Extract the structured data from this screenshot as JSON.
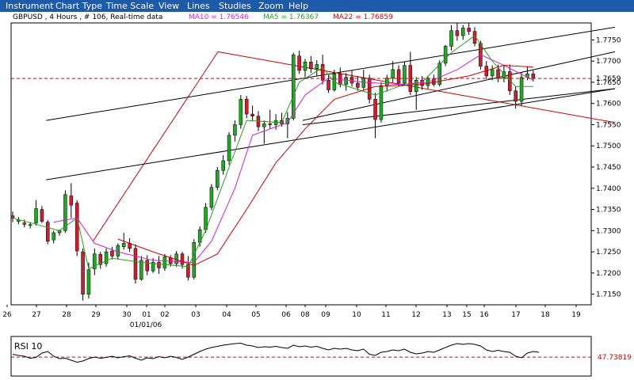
{
  "menu": {
    "items": [
      "Instrument",
      "Chart Type",
      "Time Scale",
      "View",
      "Lines",
      "Studies",
      "Zoom",
      "Help"
    ]
  },
  "header": {
    "instrument_text": "GBPUSD , 4 Hours , # 106, Real-time data",
    "ma10_text": "MA10 = 1.76546",
    "ma5_text": "MA5 = 1.76367",
    "ma22_text": "MA22 = 1.76859"
  },
  "rsi_panel": {
    "title": "RSI 10",
    "value_label": "47.73819"
  },
  "colors": {
    "menu_bg": "#1f5aa8",
    "bull": "#22a822",
    "bear": "#cc1f2e",
    "ma5": "#1fa31f",
    "ma10": "#d21fd2",
    "ma22": "#d00000",
    "trend_red": "#cc0000",
    "channel": "#000000",
    "last_price": "#e00000"
  },
  "chart_data": [
    {
      "type": "candlestick",
      "instrument": "GBPUSD",
      "timeframe": "4 Hours",
      "ylim": [
        1.7125,
        1.779
      ],
      "y_ticks": [
        "1.7750",
        "1.7700",
        "1.7650",
        "1.7600",
        "1.7550",
        "1.7500",
        "1.7450",
        "1.7400",
        "1.7350",
        "1.7300",
        "1.7250",
        "1.7200",
        "1.7150"
      ],
      "last_price_label": "1.7659",
      "last_price": 1.7659,
      "x_labels": [
        "26",
        "27",
        "28",
        "29",
        "30",
        "01",
        "02",
        "03",
        "04",
        "05",
        "06",
        "08",
        "09",
        "10",
        "11",
        "12",
        "13",
        "15",
        "16",
        "17",
        "18",
        "19"
      ],
      "x_sublabel": "01/01/06",
      "candles": [
        [
          1.7335,
          1.7345,
          1.732,
          1.733
        ],
        [
          1.7322,
          1.7332,
          1.7315,
          1.7325
        ],
        [
          1.7318,
          1.7326,
          1.7308,
          1.7315
        ],
        [
          1.7312,
          1.732,
          1.7305,
          1.7314
        ],
        [
          1.7318,
          1.7372,
          1.7312,
          1.7352
        ],
        [
          1.735,
          1.7358,
          1.7318,
          1.7322
        ],
        [
          1.732,
          1.7325,
          1.7268,
          1.7275
        ],
        [
          1.7278,
          1.73,
          1.727,
          1.7295
        ],
        [
          1.7295,
          1.7302,
          1.7288,
          1.73
        ],
        [
          1.73,
          1.7395,
          1.7295,
          1.7385
        ],
        [
          1.7382,
          1.7412,
          1.733,
          1.736
        ],
        [
          1.7365,
          1.7372,
          1.724,
          1.7252
        ],
        [
          1.725,
          1.7258,
          1.7135,
          1.715
        ],
        [
          1.715,
          1.7225,
          1.714,
          1.7208
        ],
        [
          1.721,
          1.7258,
          1.7195,
          1.7245
        ],
        [
          1.7244,
          1.725,
          1.721,
          1.722
        ],
        [
          1.7222,
          1.7258,
          1.7215,
          1.725
        ],
        [
          1.7252,
          1.7262,
          1.7232,
          1.724
        ],
        [
          1.724,
          1.727,
          1.7232,
          1.7265
        ],
        [
          1.7262,
          1.7295,
          1.7255,
          1.727
        ],
        [
          1.727,
          1.7282,
          1.725,
          1.7258
        ],
        [
          1.7258,
          1.7268,
          1.7175,
          1.7185
        ],
        [
          1.7185,
          1.724,
          1.7182,
          1.723
        ],
        [
          1.723,
          1.7242,
          1.7195,
          1.7205
        ],
        [
          1.7205,
          1.7235,
          1.72,
          1.7225
        ],
        [
          1.7225,
          1.724,
          1.7198,
          1.7212
        ],
        [
          1.7212,
          1.7245,
          1.7205,
          1.7238
        ],
        [
          1.7236,
          1.7242,
          1.7215,
          1.7222
        ],
        [
          1.7222,
          1.7252,
          1.7215,
          1.7245
        ],
        [
          1.7245,
          1.725,
          1.721,
          1.722
        ],
        [
          1.722,
          1.724,
          1.7182,
          1.719
        ],
        [
          1.719,
          1.728,
          1.7185,
          1.7272
        ],
        [
          1.7272,
          1.731,
          1.7262,
          1.7302
        ],
        [
          1.7302,
          1.7365,
          1.7295,
          1.7355
        ],
        [
          1.7355,
          1.741,
          1.7348,
          1.7402
        ],
        [
          1.7402,
          1.745,
          1.7395,
          1.7442
        ],
        [
          1.7442,
          1.7478,
          1.7432,
          1.7465
        ],
        [
          1.7465,
          1.7532,
          1.7455,
          1.7525
        ],
        [
          1.7525,
          1.756,
          1.751,
          1.755
        ],
        [
          1.755,
          1.762,
          1.754,
          1.761
        ],
        [
          1.761,
          1.7618,
          1.7565,
          1.7575
        ],
        [
          1.7575,
          1.7595,
          1.756,
          1.757
        ],
        [
          1.757,
          1.7582,
          1.7535,
          1.7545
        ],
        [
          1.7545,
          1.756,
          1.7505,
          1.7552
        ],
        [
          1.7552,
          1.7585,
          1.754,
          1.755
        ],
        [
          1.755,
          1.7575,
          1.7538,
          1.756
        ],
        [
          1.756,
          1.7578,
          1.7545,
          1.7552
        ],
        [
          1.7552,
          1.758,
          1.7518,
          1.7565
        ],
        [
          1.7565,
          1.772,
          1.756,
          1.7715
        ],
        [
          1.7712,
          1.7725,
          1.767,
          1.7678
        ],
        [
          1.7678,
          1.7705,
          1.7662,
          1.7698
        ],
        [
          1.7698,
          1.7712,
          1.7672,
          1.7682
        ],
        [
          1.7682,
          1.7702,
          1.7665,
          1.7692
        ],
        [
          1.7692,
          1.7715,
          1.7645,
          1.7655
        ],
        [
          1.7655,
          1.7668,
          1.7625,
          1.7632
        ],
        [
          1.7632,
          1.768,
          1.7628,
          1.767
        ],
        [
          1.767,
          1.7685,
          1.7638,
          1.7645
        ],
        [
          1.7645,
          1.7672,
          1.763,
          1.7662
        ],
        [
          1.7662,
          1.7678,
          1.764,
          1.7648
        ],
        [
          1.7648,
          1.7665,
          1.763,
          1.7638
        ],
        [
          1.7638,
          1.768,
          1.7632,
          1.766
        ],
        [
          1.766,
          1.7668,
          1.76,
          1.761
        ],
        [
          1.761,
          1.7625,
          1.7518,
          1.7562
        ],
        [
          1.7562,
          1.765,
          1.7555,
          1.7642
        ],
        [
          1.7642,
          1.7668,
          1.7628,
          1.766
        ],
        [
          1.766,
          1.77,
          1.765,
          1.768
        ],
        [
          1.768,
          1.769,
          1.764,
          1.7648
        ],
        [
          1.7648,
          1.7698,
          1.7642,
          1.769
        ],
        [
          1.769,
          1.7722,
          1.762,
          1.7628
        ],
        [
          1.7628,
          1.7662,
          1.7585,
          1.7655
        ],
        [
          1.7655,
          1.7665,
          1.7632,
          1.7642
        ],
        [
          1.7642,
          1.7665,
          1.7635,
          1.7658
        ],
        [
          1.7658,
          1.7668,
          1.764,
          1.7645
        ],
        [
          1.7645,
          1.7702,
          1.764,
          1.7695
        ],
        [
          1.7695,
          1.7738,
          1.7688,
          1.7735
        ],
        [
          1.7735,
          1.7785,
          1.7725,
          1.7772
        ],
        [
          1.7772,
          1.779,
          1.7748,
          1.776
        ],
        [
          1.776,
          1.7785,
          1.775,
          1.7778
        ],
        [
          1.7778,
          1.779,
          1.7762,
          1.777
        ],
        [
          1.777,
          1.778,
          1.7735,
          1.7742
        ],
        [
          1.7742,
          1.7748,
          1.768,
          1.7688
        ],
        [
          1.7688,
          1.77,
          1.7658,
          1.7665
        ],
        [
          1.7665,
          1.769,
          1.7655,
          1.768
        ],
        [
          1.768,
          1.7692,
          1.765,
          1.766
        ],
        [
          1.766,
          1.769,
          1.765,
          1.7675
        ],
        [
          1.7675,
          1.7692,
          1.762,
          1.763
        ],
        [
          1.763,
          1.764,
          1.7588,
          1.7605
        ],
        [
          1.7605,
          1.7672,
          1.7595,
          1.7662
        ],
        [
          1.7662,
          1.7688,
          1.7655,
          1.767
        ],
        [
          1.767,
          1.7678,
          1.7652,
          1.7659
        ]
      ],
      "ma_lines": [
        {
          "name": "MA5",
          "points": [
            [
              0,
              1.733
            ],
            [
              8,
              1.73
            ],
            [
              11,
              1.733
            ],
            [
              13,
              1.721
            ],
            [
              17,
              1.7235
            ],
            [
              22,
              1.7225
            ],
            [
              30,
              1.7215
            ],
            [
              33,
              1.73
            ],
            [
              37,
              1.745
            ],
            [
              40,
              1.756
            ],
            [
              46,
              1.7555
            ],
            [
              49,
              1.765
            ],
            [
              53,
              1.7685
            ],
            [
              55,
              1.765
            ],
            [
              62,
              1.762
            ],
            [
              66,
              1.764
            ],
            [
              70,
              1.765
            ],
            [
              75,
              1.772
            ],
            [
              79,
              1.776
            ],
            [
              82,
              1.77
            ],
            [
              86,
              1.764
            ],
            [
              89,
              1.764
            ]
          ]
        },
        {
          "name": "MA10",
          "points": [
            [
              7,
              1.732
            ],
            [
              11,
              1.733
            ],
            [
              14,
              1.727
            ],
            [
              18,
              1.725
            ],
            [
              24,
              1.723
            ],
            [
              31,
              1.7225
            ],
            [
              34,
              1.7275
            ],
            [
              38,
              1.74
            ],
            [
              41,
              1.7525
            ],
            [
              47,
              1.7555
            ],
            [
              50,
              1.762
            ],
            [
              54,
              1.766
            ],
            [
              60,
              1.765
            ],
            [
              66,
              1.7645
            ],
            [
              71,
              1.765
            ],
            [
              76,
              1.768
            ],
            [
              80,
              1.7715
            ],
            [
              84,
              1.769
            ],
            [
              89,
              1.7655
            ]
          ]
        },
        {
          "name": "MA22",
          "points": [
            [
              18,
              1.728
            ],
            [
              24,
              1.725
            ],
            [
              31,
              1.7218
            ],
            [
              35,
              1.7245
            ],
            [
              40,
              1.735
            ],
            [
              45,
              1.746
            ],
            [
              50,
              1.754
            ],
            [
              55,
              1.761
            ],
            [
              62,
              1.764
            ],
            [
              70,
              1.7645
            ],
            [
              78,
              1.7665
            ],
            [
              84,
              1.769
            ],
            [
              89,
              1.7686
            ]
          ]
        }
      ],
      "trend_lines": [
        {
          "name": "channel-upper",
          "color": "channel",
          "from": [
            1.5,
            1.756
          ],
          "to": [
            27,
            1.778
          ]
        },
        {
          "name": "channel-lower",
          "color": "channel",
          "from": [
            1.5,
            1.742
          ],
          "to": [
            27,
            1.7635
          ]
        },
        {
          "name": "channel-2-upper",
          "color": "channel",
          "from": [
            13,
            1.756
          ],
          "to": [
            27,
            1.7722
          ]
        },
        {
          "name": "channel-2-lower",
          "color": "channel",
          "from": [
            13,
            1.755
          ],
          "to": [
            27,
            1.7635
          ]
        },
        {
          "name": "red-resistance",
          "color": "trend_red",
          "from": [
            3.6,
            1.7275
          ],
          "to": [
            9.2,
            1.7722
          ]
        },
        {
          "name": "red-down",
          "color": "trend_red",
          "from": [
            9.2,
            1.7722
          ],
          "to": [
            27,
            1.7555
          ]
        }
      ]
    },
    {
      "type": "line",
      "title": "RSI 10",
      "ylim": [
        0,
        100
      ],
      "reference_line": 47.73819,
      "values": [
        55,
        52,
        50,
        45,
        47,
        58,
        62,
        50,
        44,
        45,
        40,
        35,
        38,
        44,
        48,
        45,
        47,
        50,
        46,
        49,
        51,
        45,
        40,
        46,
        44,
        49,
        46,
        50,
        47,
        42,
        48,
        55,
        62,
        68,
        72,
        75,
        78,
        80,
        82,
        83,
        78,
        76,
        72,
        74,
        73,
        75,
        72,
        70,
        78,
        74,
        76,
        73,
        75,
        70,
        66,
        70,
        68,
        70,
        66,
        64,
        68,
        55,
        52,
        60,
        62,
        66,
        64,
        68,
        60,
        56,
        58,
        62,
        60,
        66,
        72,
        78,
        82,
        80,
        82,
        80,
        76,
        66,
        62,
        65,
        62,
        60,
        50,
        46,
        58,
        62,
        60
      ]
    }
  ]
}
